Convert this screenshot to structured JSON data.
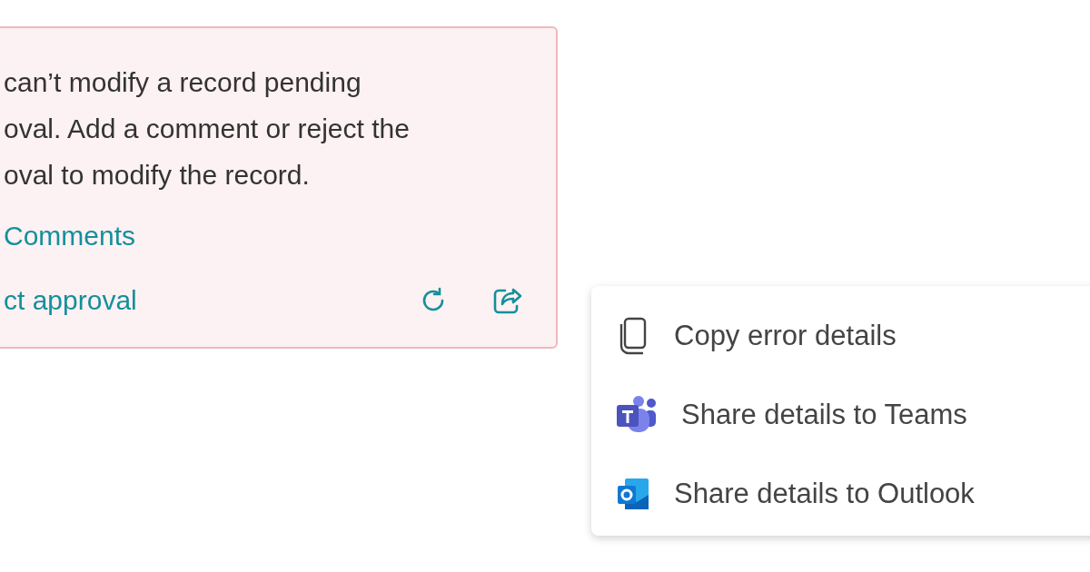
{
  "error_card": {
    "message_lines": [
      "can’t modify a record pending",
      "oval. Add a comment or reject the",
      "oval to modify the record."
    ],
    "links": [
      "Comments",
      "ct approval"
    ]
  },
  "menu": {
    "items": [
      {
        "kind": "copy",
        "label": "Copy error details"
      },
      {
        "kind": "teams",
        "label": "Share details to Teams"
      },
      {
        "kind": "outlook",
        "label": "Share details to Outlook"
      }
    ]
  }
}
